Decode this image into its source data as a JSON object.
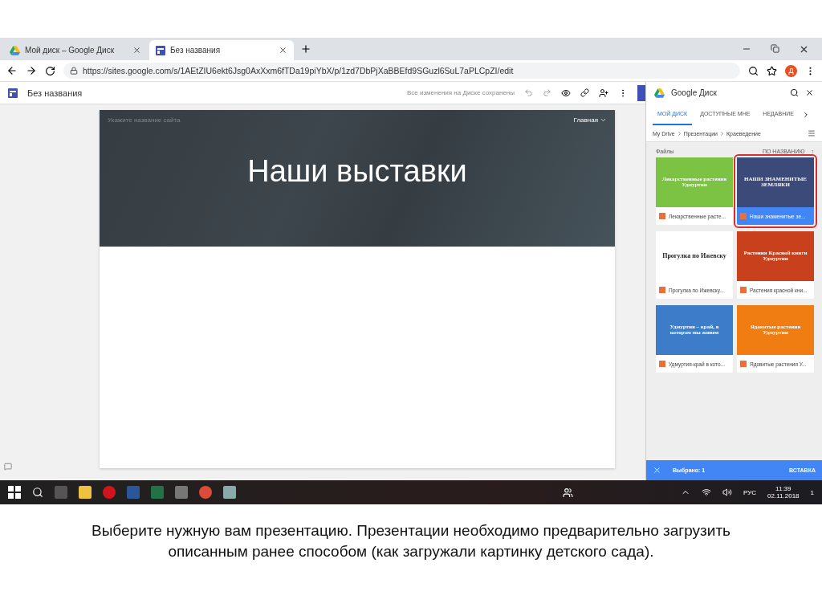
{
  "browser": {
    "tabs": [
      {
        "title": "Мой диск – Google Диск",
        "selected": false
      },
      {
        "title": "Без названия",
        "selected": true
      }
    ],
    "url": "https://sites.google.com/s/1AEtZIU6ekt6Jsg0AxXxm6fTDa19piYbX/p/1zd7DbPjXaBBEfd9SGuzl6SuL7aPLCpZI/edit",
    "avatar": "Д"
  },
  "editor": {
    "title": "Без названия",
    "save_status": "Все изменения на Диске сохранены",
    "site_name_placeholder": "Укажите название сайта",
    "nav_item": "Главная",
    "heading": "Наши выставки"
  },
  "drive_panel": {
    "title": "Google Диск",
    "tabs": [
      {
        "label": "МОЙ ДИСК",
        "selected": true
      },
      {
        "label": "ДОСТУПНЫЕ МНЕ",
        "selected": false
      },
      {
        "label": "НЕДАВНИЕ",
        "selected": false
      }
    ],
    "breadcrumb": [
      "My Drive",
      "Презентации",
      "Краеведение"
    ],
    "section": "Файлы",
    "sort": "ПО НАЗВАНИЮ",
    "sort_arrow": "↑",
    "files": [
      {
        "thumb_title": "Лекарственные растения Удмуртии",
        "name": "Лекарственные расте...",
        "color": "#7cc243",
        "selected": false
      },
      {
        "thumb_title": "НАШИ ЗНАМЕНИТЫЕ ЗЕМЛЯКИ",
        "name": "Наши знаменитые зе...",
        "color": "#3c4a7a",
        "selected": true
      },
      {
        "thumb_title": "Прогулка по Ижевску",
        "name": "Прогулка по Ижевску...",
        "color": "#ffffff",
        "selected": false
      },
      {
        "thumb_title": "Растения Красной книги Удмуртии",
        "name": "Растения красной кни...",
        "color": "#c8401c",
        "selected": false
      },
      {
        "thumb_title": "Удмуртия – край, в котором мы живем",
        "name": "Удмуртия-край в кото...",
        "color": "#3d7cc9",
        "selected": false
      },
      {
        "thumb_title": "Ядовитые растения Удмуртии",
        "name": "Ядовитые растения У...",
        "color": "#ef7d12",
        "selected": false
      }
    ],
    "selection": "Выбрано: 1",
    "insert": "ВСТАВКА"
  },
  "taskbar": {
    "language": "РУС",
    "time": "11:39",
    "date": "02.11.2018",
    "notifications": "1"
  },
  "caption": "Выберите нужную вам презентацию. Презентации необходимо предварительно загрузить описанным ранее способом (как загружали картинку детского сада)."
}
